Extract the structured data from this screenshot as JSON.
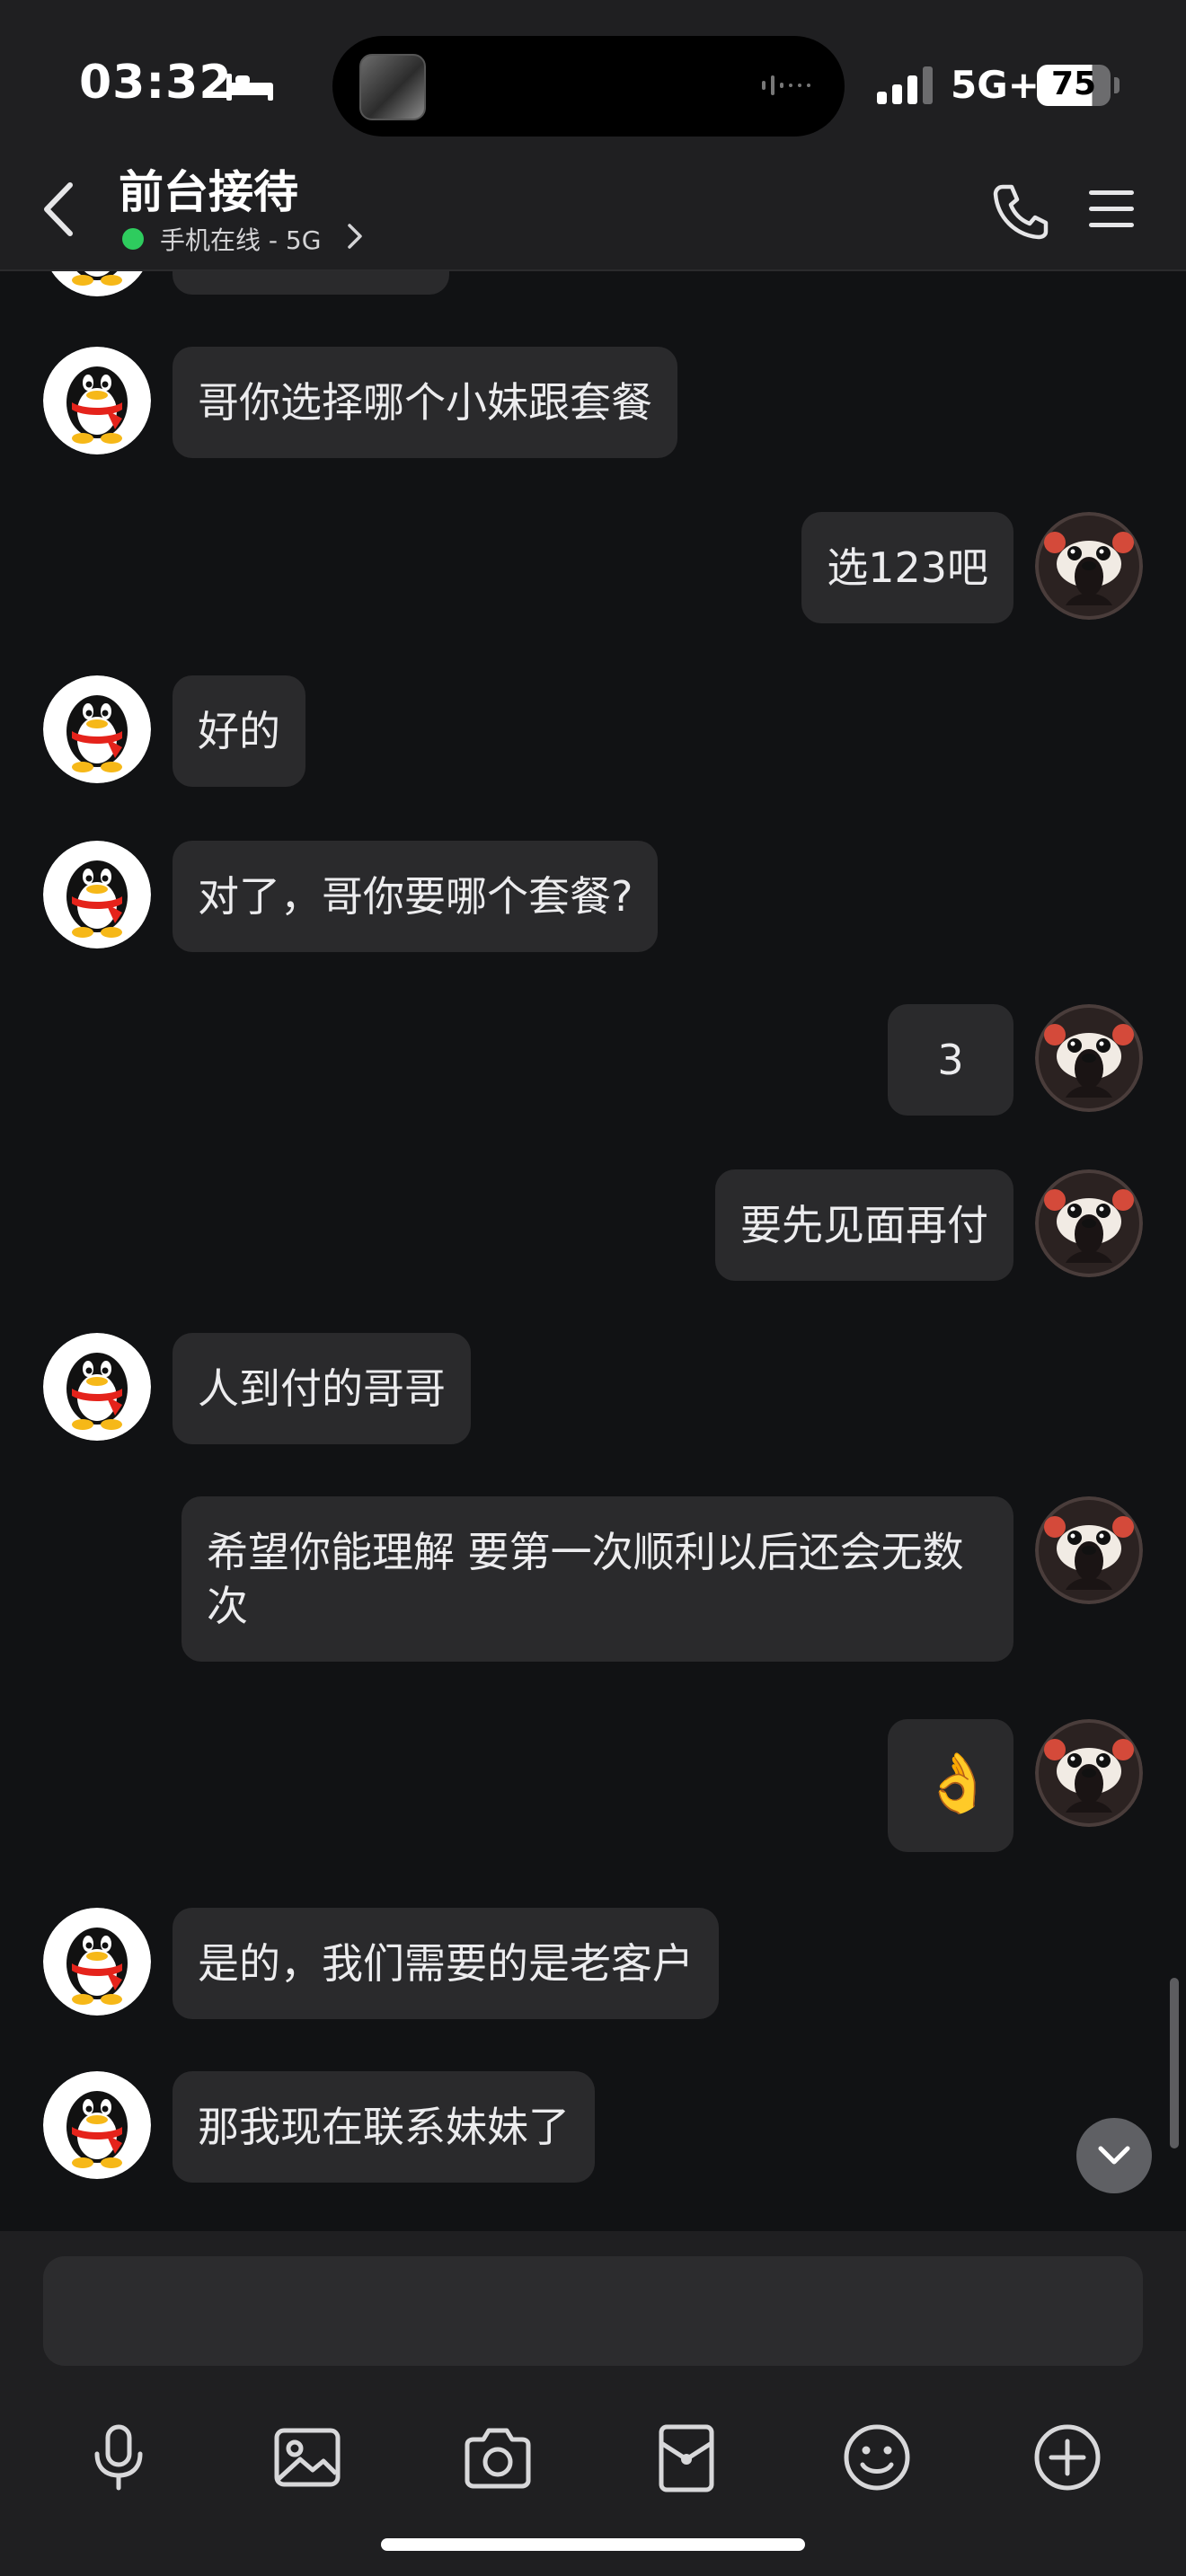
{
  "status_bar": {
    "time": "03:32",
    "network": "5G+",
    "battery": "75"
  },
  "header": {
    "contact_name": "前台接待",
    "online_status": "手机在线 - 5G"
  },
  "messages": [
    {
      "side": "left",
      "text": "哥你选择哪个小妹跟套餐"
    },
    {
      "side": "right",
      "text": "选123吧"
    },
    {
      "side": "left",
      "text": "好的"
    },
    {
      "side": "left",
      "text": "对了，哥你要哪个套餐?"
    },
    {
      "side": "right",
      "text": "3"
    },
    {
      "side": "right",
      "text": "要先见面再付"
    },
    {
      "side": "left",
      "text": "人到付的哥哥"
    },
    {
      "side": "right",
      "text": "希望你能理解 要第一次顺利以后还会无数次"
    },
    {
      "side": "right",
      "text": "👌"
    },
    {
      "side": "left",
      "text": "是的，我们需要的是老客户"
    },
    {
      "side": "left",
      "text": "那我现在联系妹妹了"
    }
  ],
  "input": {
    "value": ""
  },
  "toolbar": {
    "icons": [
      "microphone-icon",
      "image-icon",
      "camera-icon",
      "red-packet-icon",
      "emoji-icon",
      "plus-icon"
    ]
  },
  "colors": {
    "background": "#111214",
    "bubble": "#2a2a2c",
    "online": "#2ecc5e"
  }
}
